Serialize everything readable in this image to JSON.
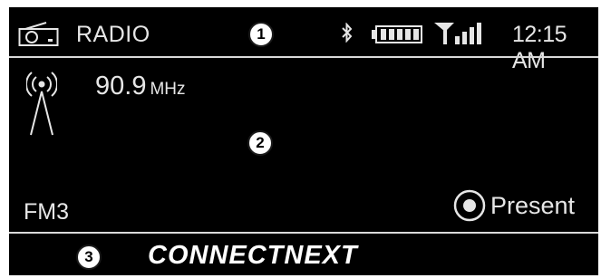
{
  "status_bar": {
    "source_icon": "radio-icon",
    "source_label": "RADIO",
    "bluetooth_icon": "bluetooth-icon",
    "battery_icon": "battery-icon",
    "signal_icon": "signal-icon",
    "time": "12:15 AM"
  },
  "main": {
    "antenna_icon": "antenna-icon",
    "frequency": "90.9",
    "frequency_unit": "MHz",
    "band": "FM3",
    "preset_icon": "radio-button-icon",
    "preset_label": "Present"
  },
  "footer": {
    "brand": "CONNECTNEXT"
  },
  "callouts": [
    "1",
    "2",
    "3"
  ],
  "colors": {
    "screen_background": "#000000",
    "text": "#e6e6e6",
    "divider": "#d9d9d9",
    "callout_background": "#ffffff"
  }
}
